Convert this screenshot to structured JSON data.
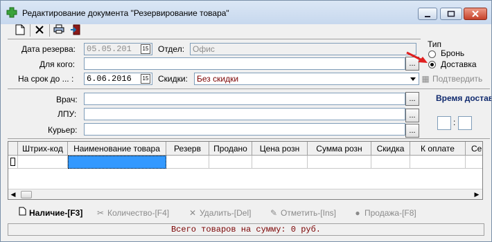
{
  "window": {
    "title": "Редактирование документа  \"Резервирование товара\"",
    "minimize_icon": "minimize-icon",
    "maximize_icon": "maximize-icon",
    "close_icon": "close-icon"
  },
  "toolbar": {
    "icons": [
      "new-document-icon",
      "delete-icon",
      "print-icon",
      "exit-icon"
    ]
  },
  "form": {
    "reserve_date_label": "Дата резерва:",
    "reserve_date_value": "05.05.201",
    "department_label": "Отдел:",
    "department_value": "Офис",
    "for_whom_label": "Для кого:",
    "for_whom_value": "",
    "term_label": "На срок до ... :",
    "term_value": "6.06.2016",
    "discounts_label": "Скидки:",
    "discounts_value": "Без скидки",
    "type_label": "Тип",
    "type_options": [
      "Бронь",
      "Доставка"
    ],
    "type_selected": "Доставка",
    "confirm_label": "Подтвердить",
    "doctor_label": "Врач:",
    "lpu_label": "ЛПУ:",
    "courier_label": "Курьер:",
    "delivery_time_label": "Время доставки",
    "delivery_time_separator": ":",
    "ellipsis": "..."
  },
  "grid": {
    "columns": [
      "Штрих-код",
      "Наименование товара",
      "Резерв",
      "Продано",
      "Цена розн",
      "Сумма розн",
      "Скидка",
      "К оплате",
      "Серия"
    ]
  },
  "actions": {
    "availability": "Наличие-[F3]",
    "quantity": "Количество-[F4]",
    "delete": "Удалить-[Del]",
    "mark": "Отметить-[Ins]",
    "sale": "Продажа-[F8]"
  },
  "status": {
    "total_text": "Всего товаров на сумму: 0 руб."
  },
  "colors": {
    "accent_red": "#e02020",
    "selected_cell": "#3399ff",
    "status_text": "#7a0000"
  }
}
